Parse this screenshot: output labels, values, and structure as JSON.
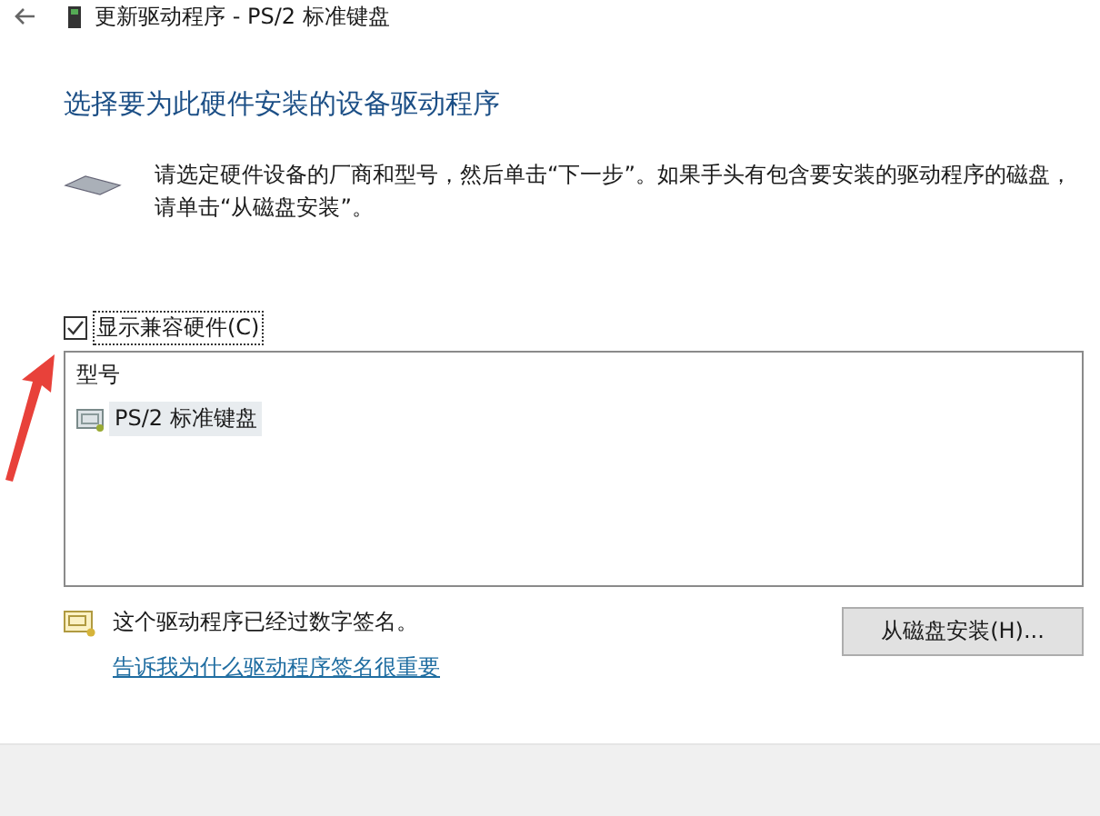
{
  "window": {
    "title": "更新驱动程序 - PS/2 标准键盘"
  },
  "heading": "选择要为此硬件安装的设备驱动程序",
  "instructions": [
    "请选定硬件设备的厂商和型号，然后单击“下一步”。如果手头有包含要安装的驱动程序的磁盘，",
    "请单击“从磁盘安装”。"
  ],
  "show_compatible": {
    "label": "显示兼容硬件(C)",
    "checked": true
  },
  "model_list": {
    "header": "型号",
    "items": [
      {
        "label": "PS/2 标准键盘",
        "selected": true
      }
    ]
  },
  "signature": {
    "text": "这个驱动程序已经过数字签名。",
    "link": "告诉我为什么驱动程序签名很重要"
  },
  "buttons": [
    "从磁盘安装(H)..."
  ]
}
